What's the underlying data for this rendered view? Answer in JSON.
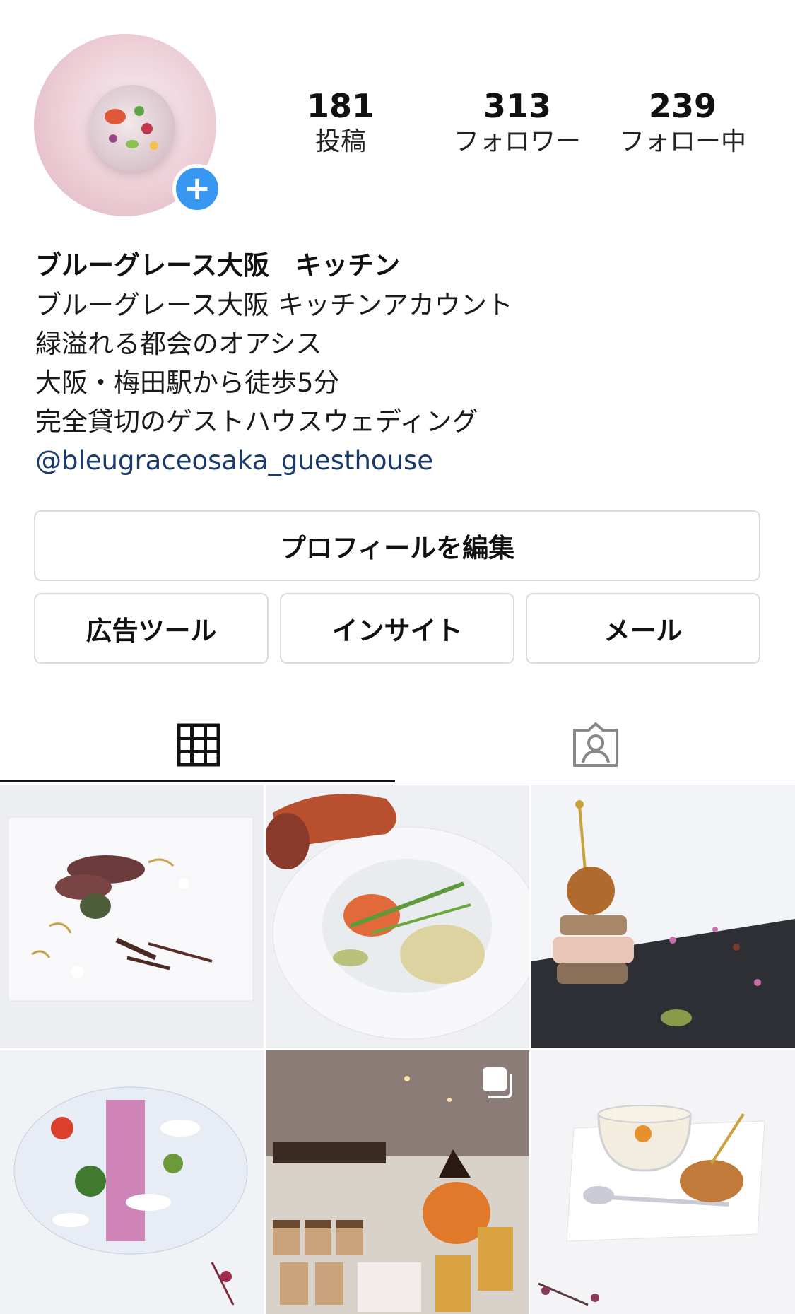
{
  "profile": {
    "stats": [
      {
        "count": "181",
        "label": "投稿"
      },
      {
        "count": "313",
        "label": "フォロワー"
      },
      {
        "count": "239",
        "label": "フォロー中"
      }
    ],
    "name": "ブルーグレース大阪　キッチン",
    "bio_lines": [
      "ブルーグレース大阪 キッチンアカウント",
      "緑溢れる都会のオアシス",
      "大阪・梅田駅から徒歩5分",
      "完全貸切のゲストハウスウェディング"
    ],
    "link_text": "@bleugraceosaka_guesthouse"
  },
  "buttons": {
    "edit_profile": "プロフィールを編集",
    "ad_tools": "広告ツール",
    "insights": "インサイト",
    "email": "メール"
  },
  "tabs": [
    {
      "name": "grid",
      "icon": "grid-icon",
      "active": true
    },
    {
      "name": "tagged",
      "icon": "tagged-person-icon",
      "active": false
    }
  ],
  "colors": {
    "accent_blue": "#3897f0",
    "link": "#1a3a6b",
    "border": "#dbdbdb"
  },
  "posts": [
    {
      "subject": "duck-plate",
      "multi": false
    },
    {
      "subject": "lobster-bowl",
      "multi": false
    },
    {
      "subject": "foie-gras-skewer",
      "multi": false
    },
    {
      "subject": "carpaccio-plate",
      "multi": false
    },
    {
      "subject": "halloween-buffet",
      "multi": true
    },
    {
      "subject": "soup-cup",
      "multi": false
    }
  ]
}
